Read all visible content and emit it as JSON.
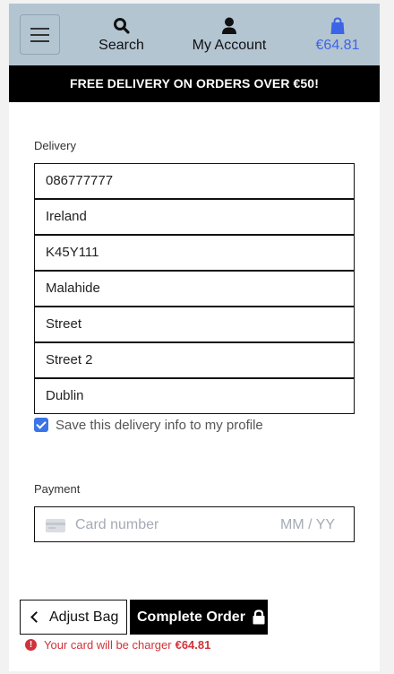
{
  "header": {
    "search_label": "Search",
    "account_label": "My Account",
    "bag_total": "€64.81",
    "accent_color": "#3c64e8"
  },
  "promo": {
    "text": "FREE DELIVERY ON ORDERS OVER €50!"
  },
  "delivery": {
    "label": "Delivery",
    "fields": {
      "phone": "086777777",
      "country": "Ireland",
      "postcode": "K45Y111",
      "town": "Malahide",
      "street1": "Street",
      "street2": "Street 2",
      "county": "Dublin"
    },
    "save_checked": true,
    "save_label": "Save this delivery info to my profile"
  },
  "payment": {
    "label": "Payment",
    "card_placeholder": "Card number",
    "expiry_placeholder": "MM / YY"
  },
  "actions": {
    "adjust_label": "Adjust Bag",
    "complete_label": "Complete Order"
  },
  "notice": {
    "icon": "!",
    "text": "Your card will be charger",
    "amount": "€64.81",
    "color": "#d1323a"
  }
}
